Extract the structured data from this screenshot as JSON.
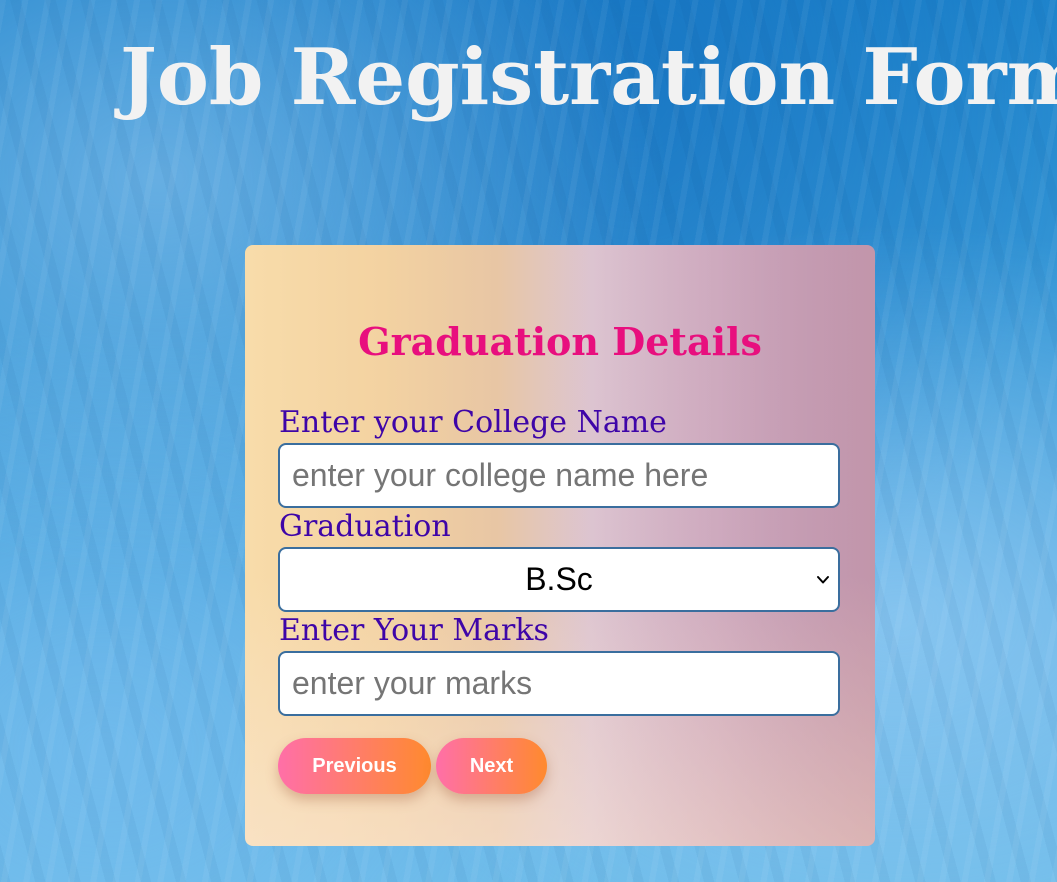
{
  "page": {
    "title": "Job Registration Form"
  },
  "form": {
    "heading": "Graduation Details",
    "college": {
      "label": "Enter your College Name",
      "value": "",
      "placeholder": "enter your college name here"
    },
    "graduation": {
      "label": "Graduation",
      "selected": "B.Sc"
    },
    "marks": {
      "label": "Enter Your Marks",
      "value": "",
      "placeholder": "enter your marks"
    },
    "buttons": {
      "previous_label": "Previous",
      "next_label": "Next"
    }
  },
  "colors": {
    "page_title": "#f2f2f2",
    "heading": "#e80f7e",
    "labels": "#3e05a8",
    "button_gradient_start": "#ff6fa8",
    "button_gradient_end": "#ff8a2e"
  }
}
